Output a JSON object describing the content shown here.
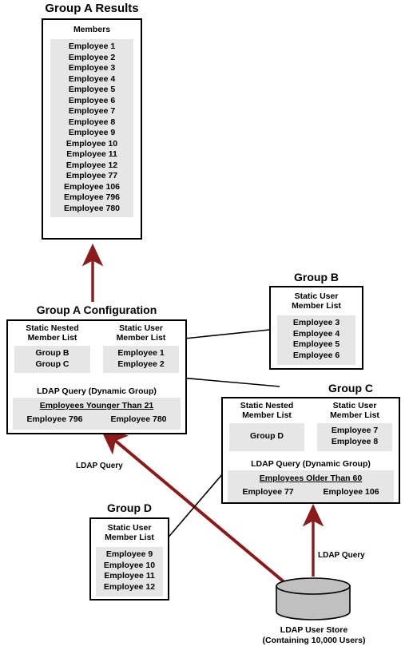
{
  "colors": {
    "arrow_red": "#8B1A1A",
    "arrow_black": "#000000",
    "shade": "#E6E6E6",
    "cylinder": "#C0C0C0",
    "border": "#000000"
  },
  "group_a_results": {
    "title": "Group A Results",
    "column_header": "Members",
    "members": [
      "Employee 1",
      "Employee 2",
      "Employee 3",
      "Employee 4",
      "Employee 5",
      "Employee 6",
      "Employee 7",
      "Employee 8",
      "Employee 9",
      "Employee 10",
      "Employee 11",
      "Employee 12",
      "Employee 77",
      "Employee 106",
      "Employee 796",
      "Employee 780"
    ]
  },
  "group_a_config": {
    "title": "Group A Configuration",
    "nested_header_line1": "Static Nested",
    "nested_header_line2": "Member List",
    "nested_members": [
      "Group B",
      "Group C"
    ],
    "user_header_line1": "Static User",
    "user_header_line2": "Member List",
    "user_members": [
      "Employee 1",
      "Employee 2"
    ],
    "ldap_header": "LDAP Query (Dynamic Group)",
    "ldap_query": "Employees Younger Than 21",
    "ldap_results": [
      "Employee 796",
      "Employee 780"
    ]
  },
  "group_b": {
    "title": "Group B",
    "user_header_line1": "Static User",
    "user_header_line2": "Member List",
    "user_members": [
      "Employee 3",
      "Employee 4",
      "Employee 5",
      "Employee 6"
    ]
  },
  "group_c": {
    "title": "Group C",
    "nested_header_line1": "Static Nested",
    "nested_header_line2": "Member List",
    "nested_members": [
      "Group D"
    ],
    "user_header_line1": "Static User",
    "user_header_line2": "Member List",
    "user_members": [
      "Employee 7",
      "Employee 8"
    ],
    "ldap_header": "LDAP Query (Dynamic Group)",
    "ldap_query": "Employees Older Than 60",
    "ldap_results": [
      "Employee 77",
      "Employee 106"
    ]
  },
  "group_d": {
    "title": "Group D",
    "user_header_line1": "Static User",
    "user_header_line2": "Member List",
    "user_members": [
      "Employee 9",
      "Employee 10",
      "Employee 11",
      "Employee 12"
    ]
  },
  "ldap_store": {
    "caption_line1": "LDAP User Store",
    "caption_line2": "(Containing 10,000 Users)"
  },
  "edge_labels": {
    "ldap_query_left": "LDAP Query",
    "ldap_query_right": "LDAP Query"
  }
}
